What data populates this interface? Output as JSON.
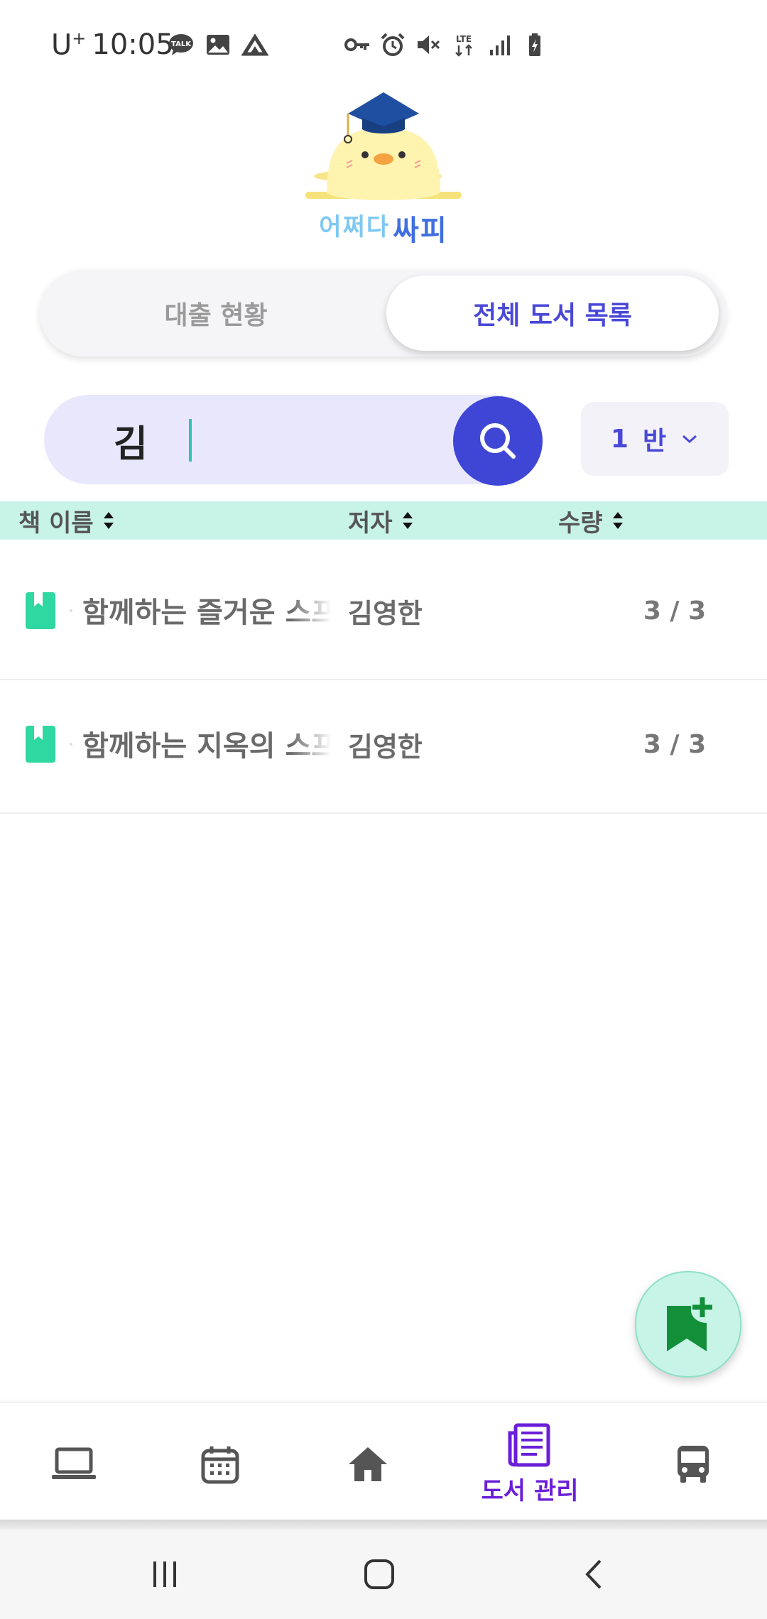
{
  "status_bar": {
    "carrier": "U",
    "carrier_sup": "+",
    "time": "10:05",
    "left_icons": [
      "talk-icon",
      "image-icon",
      "app-icon"
    ],
    "right_icons": [
      "key-icon",
      "alarm-icon",
      "mute-icon",
      "lte-icon",
      "signal-icon",
      "battery-icon"
    ]
  },
  "logo": {
    "text_part1": "어쩌다",
    "text_part2": "싸피"
  },
  "tabs": {
    "loan_status": "대출 현황",
    "all_books": "전체 도서 목록",
    "active": "all_books"
  },
  "search": {
    "value": "김",
    "placeholder": "",
    "class_select": "1",
    "class_unit": "반"
  },
  "table": {
    "headers": [
      "책 이름",
      "저자",
      "수량"
    ],
    "rows": [
      {
        "title": "함께하는 즐거운 스프링",
        "author": "김영한",
        "quantity": "3 / 3"
      },
      {
        "title": "함께하는 지옥의 스프링",
        "author": "김영한",
        "quantity": "3 / 3"
      }
    ]
  },
  "bottom_nav": {
    "items": [
      {
        "icon": "laptop-icon",
        "label": ""
      },
      {
        "icon": "calendar-icon",
        "label": ""
      },
      {
        "icon": "home-icon",
        "label": ""
      },
      {
        "icon": "book-management-icon",
        "label": "도서 관리"
      },
      {
        "icon": "bus-icon",
        "label": ""
      }
    ],
    "active_color": "#6a1ed8"
  },
  "colors": {
    "accent": "#4a48d6",
    "search_bg": "#e8e7fb",
    "header_bg": "#c8f4e8",
    "book_icon": "#2ed8a0"
  }
}
